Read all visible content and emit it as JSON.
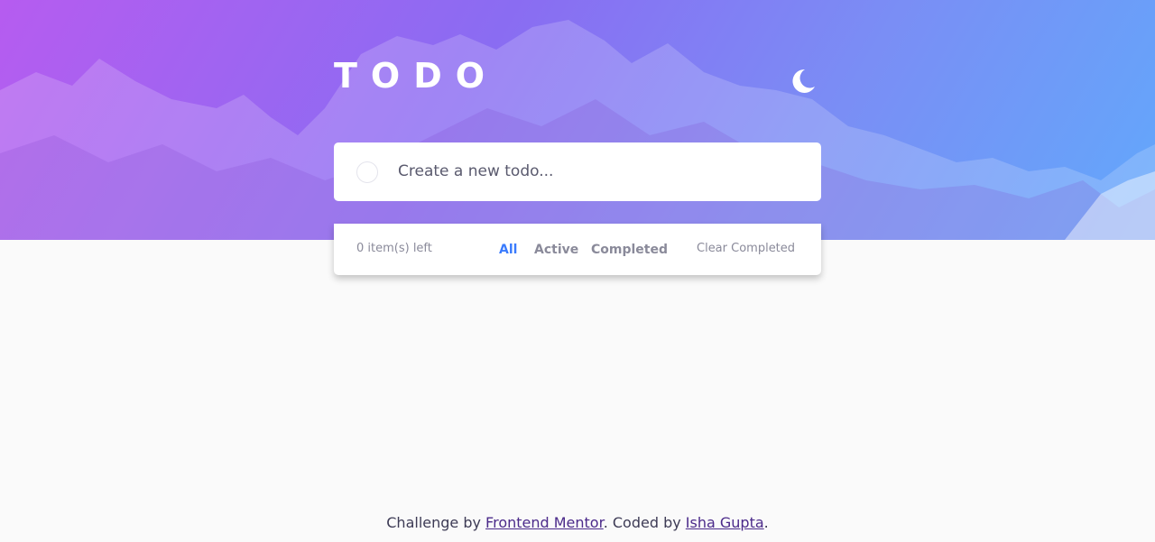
{
  "header": {
    "title": "TODO",
    "theme_toggle_icon": "moon-icon"
  },
  "new_todo": {
    "placeholder": "Create a new todo..."
  },
  "footer_bar": {
    "items_left": "0 item(s) left",
    "filters": {
      "all": "All",
      "active": "Active",
      "completed": "Completed"
    },
    "selected_filter": "All",
    "clear_completed": "Clear Completed"
  },
  "credit": {
    "prefix": "Challenge by ",
    "frontend_mentor": "Frontend Mentor",
    "middle": ". Coded by ",
    "author": "Isha Gupta",
    "suffix": "."
  },
  "colors": {
    "accent": "#3a7bfd",
    "gradient_start": "#b65cf0",
    "gradient_end": "#62a8fb",
    "page_bg": "#fafafa"
  }
}
